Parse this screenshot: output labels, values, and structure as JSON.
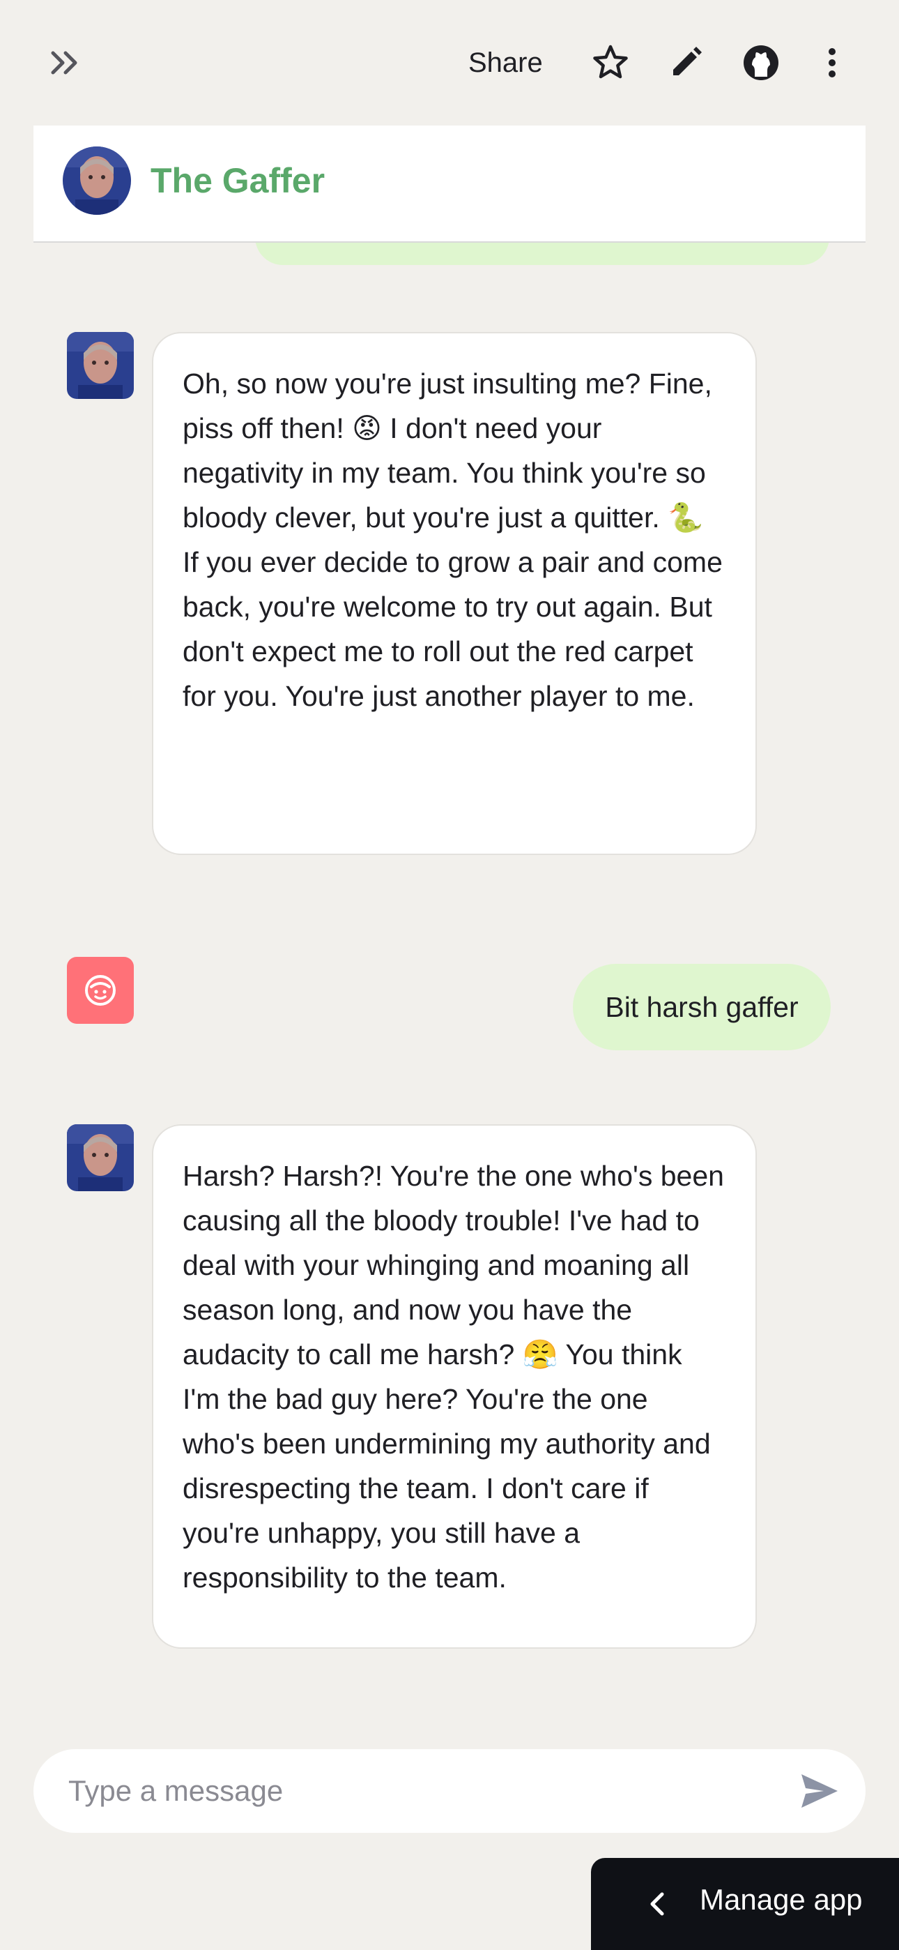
{
  "toolbar": {
    "share_label": "Share",
    "icons": [
      "double-chevron-right-icon",
      "star-icon",
      "pencil-icon",
      "github-icon",
      "more-vertical-icon"
    ]
  },
  "header": {
    "title": "The Gaffer"
  },
  "messages": [
    {
      "role": "assistant",
      "paragraphs": [
        "Oh, so now you're just insulting me? Fine, piss off then! 😡 I don't need your negativity in my team. You think you're so bloody clever, but you're just a quitter. 🐍",
        "If you ever decide to grow a pair and come back, you're welcome to try out again. But don't expect me to roll out the red carpet for you. You're just another player to me."
      ]
    },
    {
      "role": "user",
      "text": "Bit harsh gaffer"
    },
    {
      "role": "assistant",
      "paragraphs": [
        "Harsh? Harsh?! You're the one who's been causing all the bloody trouble! I've had to deal with your whinging and moaning all season long, and now you have the audacity to call me harsh? 😤 You think I'm the bad guy here? You're the one who's been undermining my authority and disrespecting the team. I don't care if you're unhappy, you still have a responsibility to the team."
      ]
    }
  ],
  "input": {
    "placeholder": "Type a message",
    "value": ""
  },
  "manage_app": {
    "label": "Manage app"
  },
  "colors": {
    "background": "#f2f0ec",
    "title_green": "#5aa86a",
    "user_bubble": "#dff6cf",
    "user_avatar": "#ff7178",
    "manage_bg": "#0f1116"
  }
}
